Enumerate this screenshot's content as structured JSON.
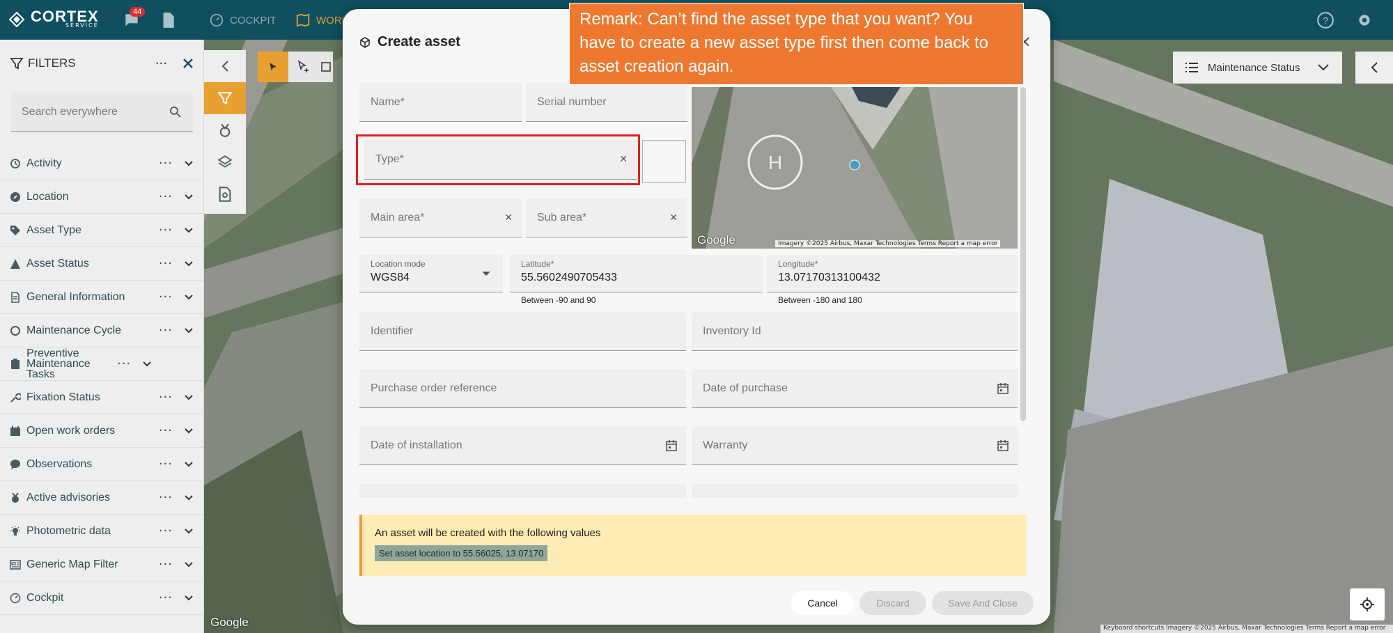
{
  "app": {
    "logo_text": "CORTEX",
    "logo_sub": "SERVICE",
    "notification_count": "44",
    "nav": [
      {
        "label": "COCKPIT"
      },
      {
        "label": "WORK"
      }
    ]
  },
  "filters": {
    "title": "FILTERS",
    "search_placeholder": "Search everywhere",
    "items": [
      {
        "label": "Activity"
      },
      {
        "label": "Location"
      },
      {
        "label": "Asset Type"
      },
      {
        "label": "Asset Status"
      },
      {
        "label": "General Information"
      },
      {
        "label": "Maintenance Cycle"
      },
      {
        "label": "Preventive Maintenance Tasks"
      },
      {
        "label": "Fixation Status"
      },
      {
        "label": "Open work orders"
      },
      {
        "label": "Observations"
      },
      {
        "label": "Active advisories"
      },
      {
        "label": "Photometric data"
      },
      {
        "label": "Generic Map Filter"
      },
      {
        "label": "Cockpit"
      }
    ]
  },
  "map": {
    "layer_select": "Maintenance Status",
    "google": "Google",
    "attribution": "Keyboard shortcuts   Imagery ©2025 Airbus, Maxar Technologies   Terms   Report a map error"
  },
  "modal": {
    "title": "Create asset",
    "fields": {
      "name": "Name*",
      "serial": "Serial number",
      "type": "Type*",
      "main_area": "Main area*",
      "sub_area": "Sub area*",
      "location_mode_label": "Location mode",
      "location_mode_value": "WGS84",
      "latitude_label": "Latitude*",
      "latitude_value": "55.5602490705433",
      "latitude_hint": "Between -90 and 90",
      "longitude_label": "Longitude*",
      "longitude_value": "13.07170313100432",
      "longitude_hint": "Between -180 and 180",
      "identifier": "Identifier",
      "inventory": "Inventory Id",
      "po_ref": "Purchase order reference",
      "date_purchase": "Date of purchase",
      "date_install": "Date of installation",
      "warranty": "Warranty"
    },
    "mini_map": {
      "google": "Google",
      "attribution": "Imagery ©2025 Airbus, Maxar Technologies   Terms   Report a map error"
    },
    "info": {
      "line": "An asset will be created with the following values",
      "tag": "Set asset location to 55.56025, 13.07170"
    },
    "buttons": {
      "cancel": "Cancel",
      "discard": "Discard",
      "save": "Save And Close"
    }
  },
  "remark": {
    "text": "Remark: Can’t find the asset type that you want? You have to create a new asset type first then come back to asset creation again."
  }
}
